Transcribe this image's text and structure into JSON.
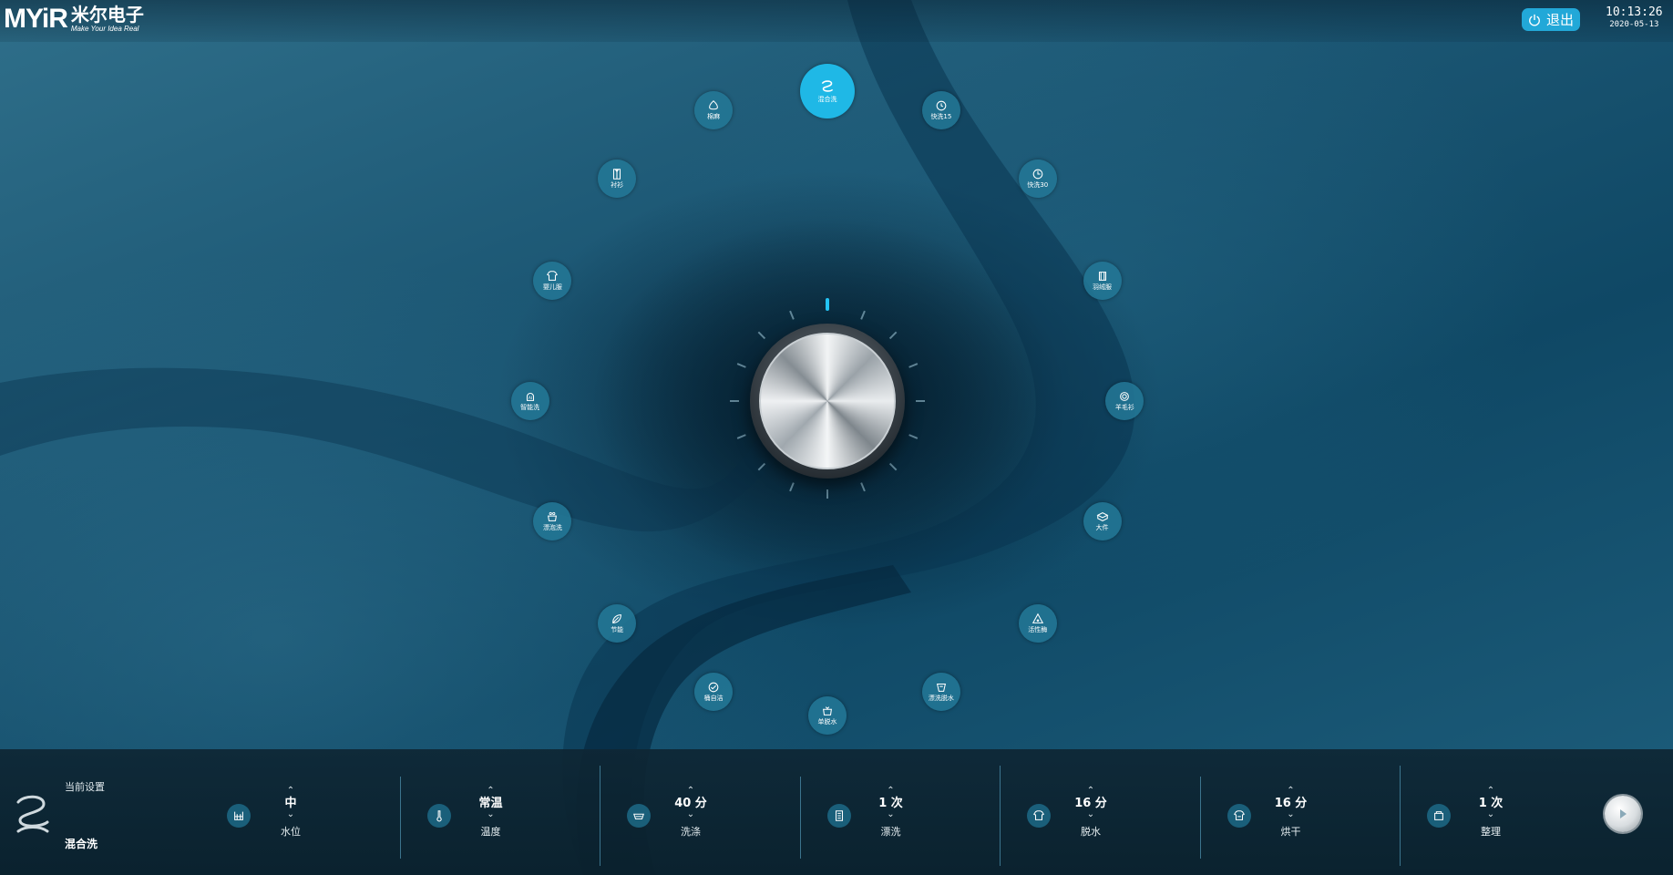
{
  "brand": {
    "logo_text": "MYiR",
    "logo_cn": "米尔电子",
    "slogan": "Make Your Idea Real"
  },
  "header": {
    "exit_label": "退出",
    "time": "10:13:26",
    "date": "2020-05-13"
  },
  "programs": [
    {
      "label": "混合洗",
      "icon": "mixed-wash-icon",
      "selected": true
    },
    {
      "label": "快洗15",
      "icon": "quick-15-icon",
      "selected": false
    },
    {
      "label": "快洗30",
      "icon": "quick-30-icon",
      "selected": false
    },
    {
      "label": "羽绒服",
      "icon": "down-jacket-icon",
      "selected": false
    },
    {
      "label": "羊毛衫",
      "icon": "wool-icon",
      "selected": false
    },
    {
      "label": "大件",
      "icon": "large-items-icon",
      "selected": false
    },
    {
      "label": "活性酶",
      "icon": "enzyme-icon",
      "selected": false
    },
    {
      "label": "漂洗脱水",
      "icon": "rinse-spin-icon",
      "selected": false
    },
    {
      "label": "单脱水",
      "icon": "spin-only-icon",
      "selected": false
    },
    {
      "label": "桶自洁",
      "icon": "drum-clean-icon",
      "selected": false
    },
    {
      "label": "节能",
      "icon": "eco-leaf-icon",
      "selected": false
    },
    {
      "label": "漂泡洗",
      "icon": "soak-wash-icon",
      "selected": false
    },
    {
      "label": "智能洗",
      "icon": "smart-wash-icon",
      "selected": false
    },
    {
      "label": "婴儿服",
      "icon": "baby-clothes-icon",
      "selected": false
    },
    {
      "label": "衬衫",
      "icon": "shirt-icon",
      "selected": false
    },
    {
      "label": "棉麻",
      "icon": "cotton-linen-icon",
      "selected": false
    }
  ],
  "current": {
    "caption": "当前设置",
    "program": "混合洗"
  },
  "settings": [
    {
      "label": "水位",
      "value": "中",
      "icon": "water-level-icon"
    },
    {
      "label": "温度",
      "value": "常温",
      "icon": "thermometer-icon"
    },
    {
      "label": "洗涤",
      "value": "40 分",
      "icon": "wash-tub-icon"
    },
    {
      "label": "漂洗",
      "value": "1 次",
      "icon": "rinse-icon"
    },
    {
      "label": "脱水",
      "value": "16 分",
      "icon": "spin-icon"
    },
    {
      "label": "烘干",
      "value": "16 分",
      "icon": "dry-icon"
    },
    {
      "label": "整理",
      "value": "1 次",
      "icon": "tidy-icon"
    }
  ],
  "colors": {
    "accent": "#1fb8e6",
    "program_bg": "#23789a",
    "bottom_bar": "#0e2634"
  }
}
